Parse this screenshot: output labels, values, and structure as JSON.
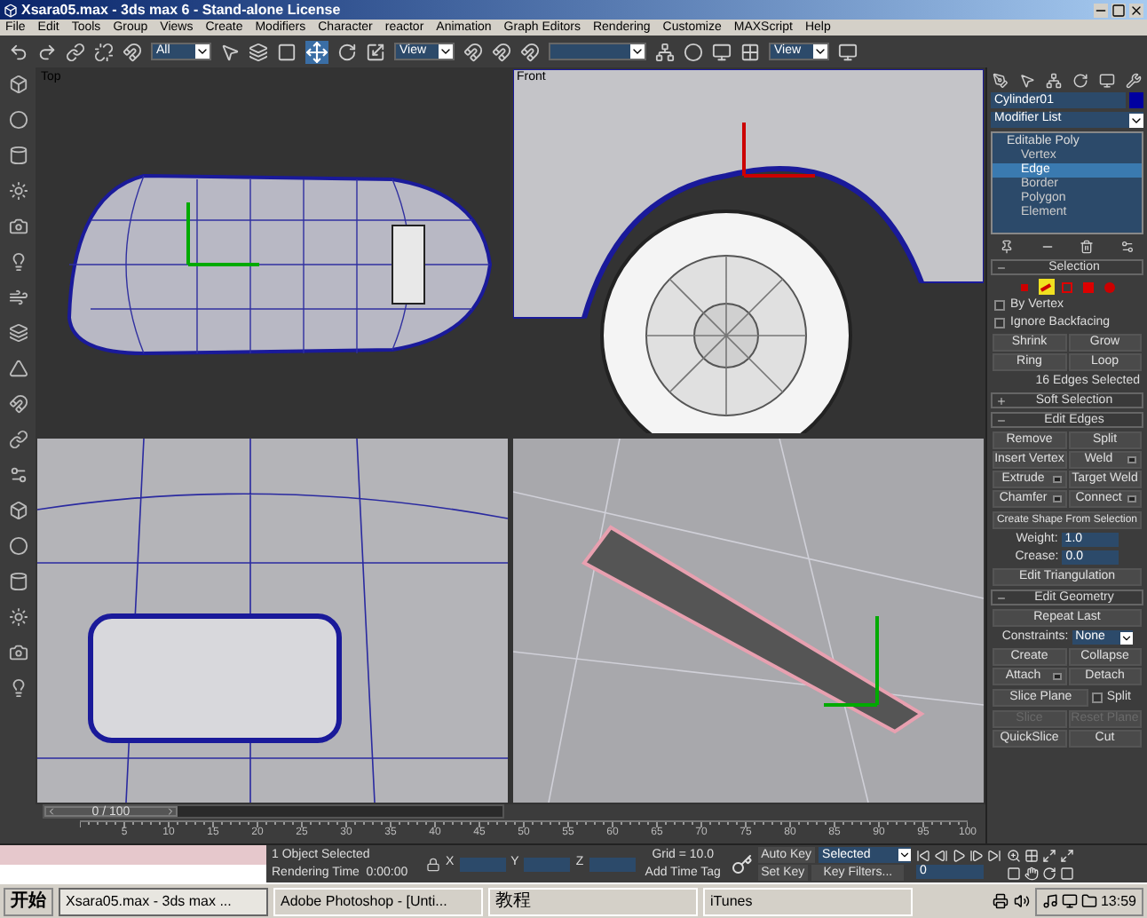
{
  "window": {
    "title": "Xsara05.max - 3ds max 6 - Stand-alone License"
  },
  "menu": [
    "File",
    "Edit",
    "Tools",
    "Group",
    "Views",
    "Create",
    "Modifiers",
    "Character",
    "reactor",
    "Animation",
    "Graph Editors",
    "Rendering",
    "Customize",
    "MAXScript",
    "Help"
  ],
  "toolbar": {
    "selection_filter": "All",
    "reference_coordinates": "View",
    "render_type": "View"
  },
  "viewports": [
    {
      "kind": "top_car",
      "label": "Top"
    },
    {
      "kind": "front_wheel",
      "label": "Front"
    },
    {
      "kind": "window_closeup"
    },
    {
      "kind": "vent_closeup"
    }
  ],
  "command_panel": {
    "object_name": "Cylinder01",
    "modifier_list": "Modifier List",
    "stack": [
      {
        "label": "Editable Poly",
        "selected": false,
        "children": [
          {
            "label": "Vertex",
            "selected": false
          },
          {
            "label": "Edge",
            "selected": true
          },
          {
            "label": "Border",
            "selected": false
          },
          {
            "label": "Polygon",
            "selected": false
          },
          {
            "label": "Element",
            "selected": false
          }
        ]
      }
    ],
    "selection": {
      "title": "Selection",
      "expanded": true,
      "subobjects": [
        {
          "kind": "vertex",
          "selected": false
        },
        {
          "kind": "edge",
          "selected": true
        },
        {
          "kind": "border",
          "selected": false
        },
        {
          "kind": "polygon",
          "selected": false
        },
        {
          "kind": "element",
          "selected": false
        }
      ],
      "checkboxes": [
        {
          "label": "By Vertex",
          "checked": false
        },
        {
          "label": "Ignore Backfacing",
          "checked": false
        }
      ],
      "buttons": [
        "Shrink",
        "Grow",
        "Ring",
        "Loop"
      ],
      "status": "16 Edges Selected"
    },
    "soft_selection": {
      "title": "Soft Selection",
      "expanded": false
    },
    "edit_edges": {
      "title": "Edit Edges",
      "expanded": true,
      "buttons": [
        {
          "label": "Remove",
          "settings": false
        },
        {
          "label": "Split",
          "settings": false
        },
        {
          "label": "Insert Vertex",
          "settings": false
        },
        {
          "label": "Weld",
          "settings": true
        },
        {
          "label": "Extrude",
          "settings": true
        },
        {
          "label": "Target Weld",
          "settings": false
        },
        {
          "label": "Chamfer",
          "settings": true
        },
        {
          "label": "Connect",
          "settings": true
        }
      ],
      "create_shape": "Create Shape From Selection",
      "spinners": [
        {
          "label": "Weight:",
          "value": "1.0"
        },
        {
          "label": "Crease:",
          "value": "0.0"
        }
      ],
      "edit_triangulation": "Edit Triangulation"
    },
    "edit_geometry": {
      "title": "Edit Geometry",
      "expanded": true,
      "repeat": "Repeat Last",
      "constraints": {
        "label": "Constraints:",
        "value": "None"
      },
      "buttons": [
        {
          "label": "Create",
          "settings": false
        },
        {
          "label": "Collapse",
          "settings": false
        },
        {
          "label": "Attach",
          "settings": true
        },
        {
          "label": "Detach",
          "settings": false
        }
      ],
      "slice_plane": "Slice Plane",
      "split": {
        "label": "Split",
        "checked": false
      },
      "disabled_buttons": [
        {
          "label": "Slice",
          "disabled": true
        },
        {
          "label": "Reset Plane",
          "disabled": true
        }
      ],
      "bottom_buttons": [
        "QuickSlice",
        "Cut"
      ]
    }
  },
  "time_slider": {
    "label": "0 / 100",
    "level": 0,
    "ticks": [
      "5",
      "10",
      "15",
      "20",
      "25",
      "30",
      "35",
      "40",
      "45",
      "50",
      "55",
      "60",
      "65",
      "70",
      "75",
      "80",
      "85",
      "90",
      "95",
      "100"
    ]
  },
  "status_bar": {
    "selection": "1 Object Selected",
    "prompt": "Rendering Time  0:00:00",
    "x_label": "X",
    "y_label": "Y",
    "z_label": "Z",
    "grid": "Grid = 10.0",
    "add_time_tag": "Add Time Tag",
    "auto_key": "Auto Key",
    "key_mode": "Selected",
    "set_key": "Set Key",
    "key_filters": "Key Filters...",
    "frame": "0"
  },
  "taskbar": {
    "start": "开始",
    "tasks": [
      {
        "label": "Xsara05.max - 3ds max ...",
        "selected": true
      },
      {
        "label": "Adobe Photoshop - [Unti...",
        "selected": false
      },
      {
        "label": "教程",
        "selected": false
      },
      {
        "label": "iTunes",
        "selected": false
      }
    ],
    "clock": "13:59"
  }
}
